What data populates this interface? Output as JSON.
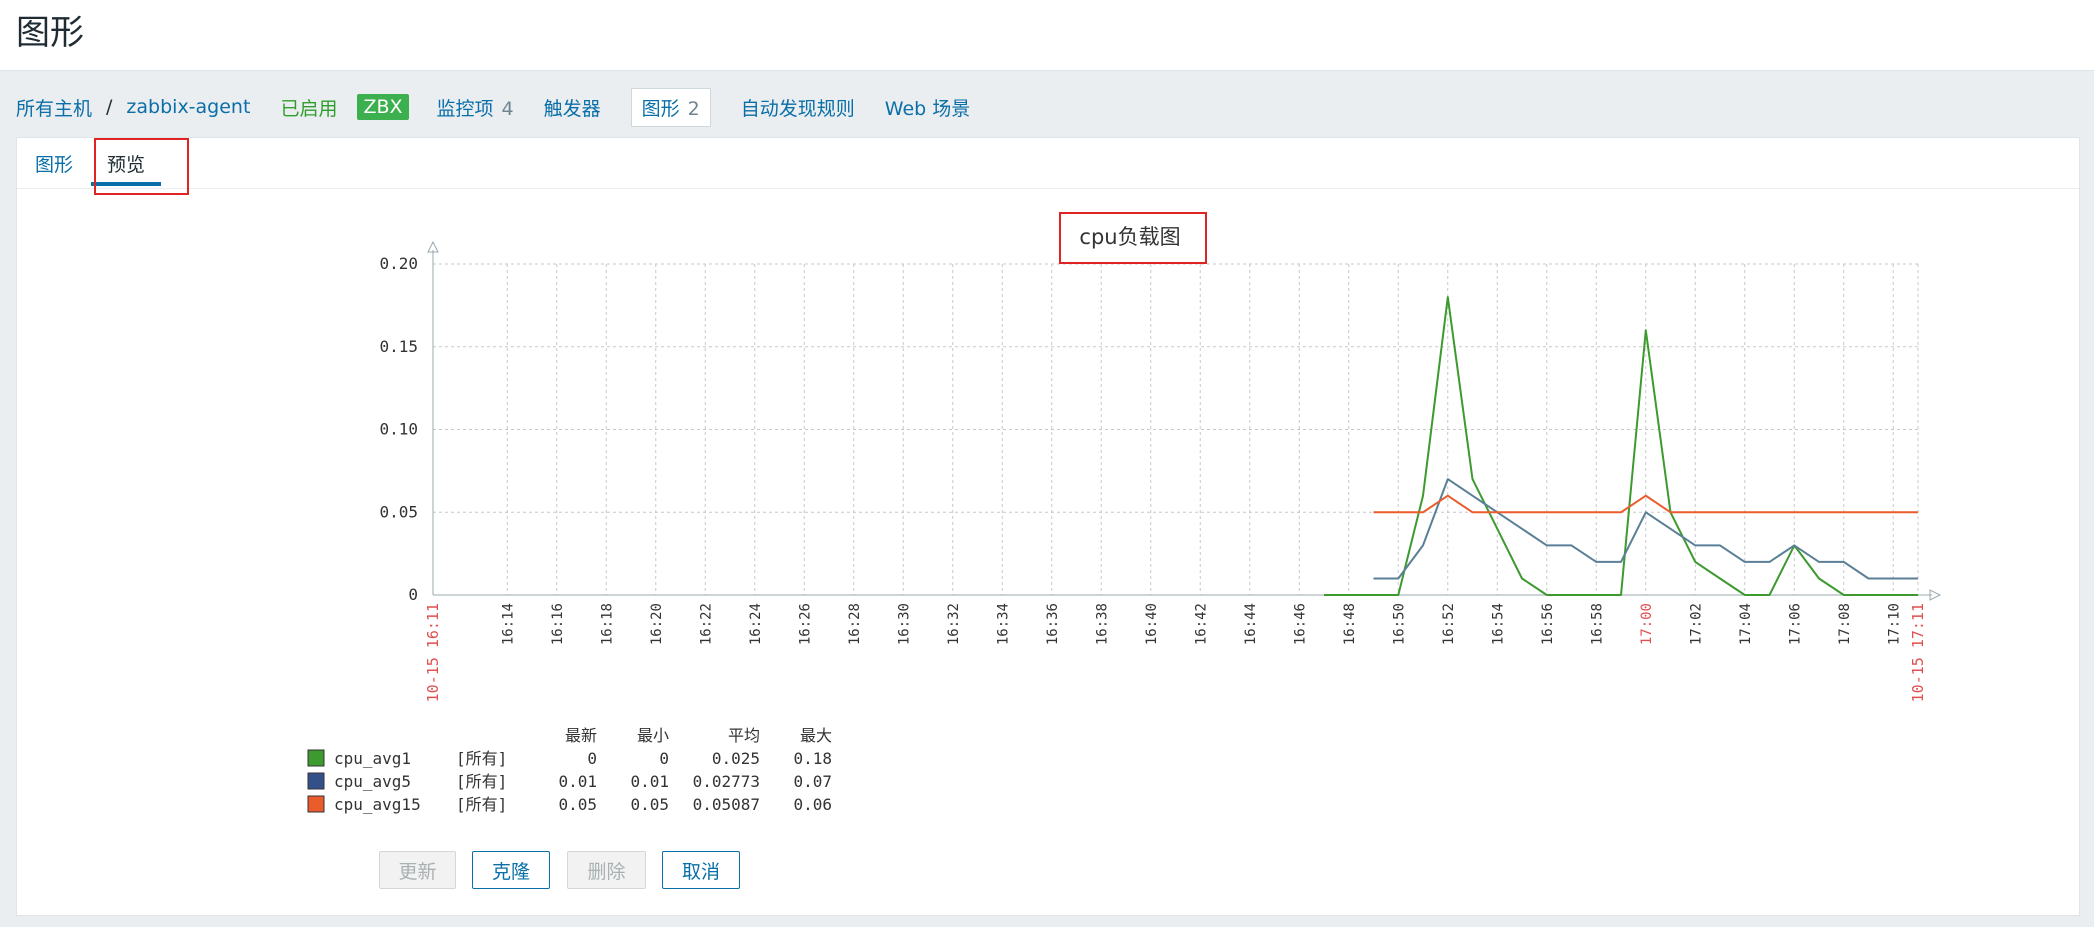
{
  "page": {
    "title": "图形"
  },
  "host_nav": {
    "all_hosts": "所有主机",
    "separator": "/",
    "host_name": "zabbix-agent",
    "status": "已启用",
    "zbx_badge": "ZBX",
    "items_label": "监控项",
    "items_count": "4",
    "triggers_label": "触发器",
    "graphs_label": "图形",
    "graphs_count": "2",
    "discovery_label": "自动发现规则",
    "web_label": "Web 场景"
  },
  "subtabs": {
    "graph": "图形",
    "preview": "预览"
  },
  "buttons": {
    "update": "更新",
    "clone": "克隆",
    "delete": "删除",
    "cancel": "取消"
  },
  "colors": {
    "green": "#3d9a2f",
    "blue": "#5a7f96",
    "orange": "#ea5c2c",
    "link": "#0a6fa8"
  },
  "chart_data": {
    "type": "line",
    "title": "cpu负载图",
    "ylim": [
      0,
      0.2
    ],
    "yticks": [
      "0.20",
      "0.15",
      "0.10",
      "0.05",
      "0"
    ],
    "xlabels": [
      "16:14",
      "16:16",
      "16:18",
      "16:20",
      "16:22",
      "16:24",
      "16:26",
      "16:28",
      "16:30",
      "16:32",
      "16:34",
      "16:36",
      "16:38",
      "16:40",
      "16:42",
      "16:44",
      "16:46",
      "16:48",
      "16:50",
      "16:52",
      "16:54",
      "16:56",
      "16:58",
      "17:00",
      "17:02",
      "17:04",
      "17:06",
      "17:08",
      "17:10"
    ],
    "start_label": "10-15 16:11",
    "end_label": "10-15 17:11",
    "series": [
      {
        "name": "cpu_avg1",
        "color": "#3d9a2f",
        "x": [
          "16:47",
          "16:50",
          "16:51",
          "16:52",
          "16:53",
          "16:54",
          "16:55",
          "16:56",
          "16:57",
          "16:58",
          "16:59",
          "17:00",
          "17:01",
          "17:02",
          "17:03",
          "17:04",
          "17:05",
          "17:06",
          "17:07",
          "17:08",
          "17:09",
          "17:10",
          "17:11"
        ],
        "y": [
          0,
          0,
          0.06,
          0.18,
          0.07,
          0.04,
          0.01,
          0,
          0,
          0,
          0,
          0.16,
          0.05,
          0.02,
          0.01,
          0,
          0,
          0.03,
          0.01,
          0,
          0,
          0,
          0
        ]
      },
      {
        "name": "cpu_avg5",
        "color": "#5a7f96",
        "x": [
          "16:49",
          "16:50",
          "16:51",
          "16:52",
          "16:53",
          "16:54",
          "16:55",
          "16:56",
          "16:57",
          "16:58",
          "16:59",
          "17:00",
          "17:01",
          "17:02",
          "17:03",
          "17:04",
          "17:05",
          "17:06",
          "17:07",
          "17:08",
          "17:09",
          "17:10",
          "17:11"
        ],
        "y": [
          0.01,
          0.01,
          0.03,
          0.07,
          0.06,
          0.05,
          0.04,
          0.03,
          0.03,
          0.02,
          0.02,
          0.05,
          0.04,
          0.03,
          0.03,
          0.02,
          0.02,
          0.03,
          0.02,
          0.02,
          0.01,
          0.01,
          0.01
        ]
      },
      {
        "name": "cpu_avg15",
        "color": "#ea5c2c",
        "x": [
          "16:49",
          "16:51",
          "16:52",
          "16:53",
          "16:54",
          "16:55",
          "16:56",
          "16:57",
          "16:58",
          "16:59",
          "17:00",
          "17:01",
          "17:02",
          "17:11"
        ],
        "y": [
          0.05,
          0.05,
          0.06,
          0.05,
          0.05,
          0.05,
          0.05,
          0.05,
          0.05,
          0.05,
          0.06,
          0.05,
          0.05,
          0.05
        ]
      }
    ],
    "legend": {
      "headers": [
        "最新",
        "最小",
        "平均",
        "最大"
      ],
      "rows": [
        {
          "name": "cpu_avg1",
          "func": "[所有]",
          "last": "0",
          "min": "0",
          "avg": "0.025",
          "max": "0.18",
          "color": "#3d9a2f"
        },
        {
          "name": "cpu_avg5",
          "func": "[所有]",
          "last": "0.01",
          "min": "0.01",
          "avg": "0.02773",
          "max": "0.07",
          "color": "#34508a"
        },
        {
          "name": "cpu_avg15",
          "func": "[所有]",
          "last": "0.05",
          "min": "0.05",
          "avg": "0.05087",
          "max": "0.06",
          "color": "#ea5c2c"
        }
      ]
    }
  }
}
